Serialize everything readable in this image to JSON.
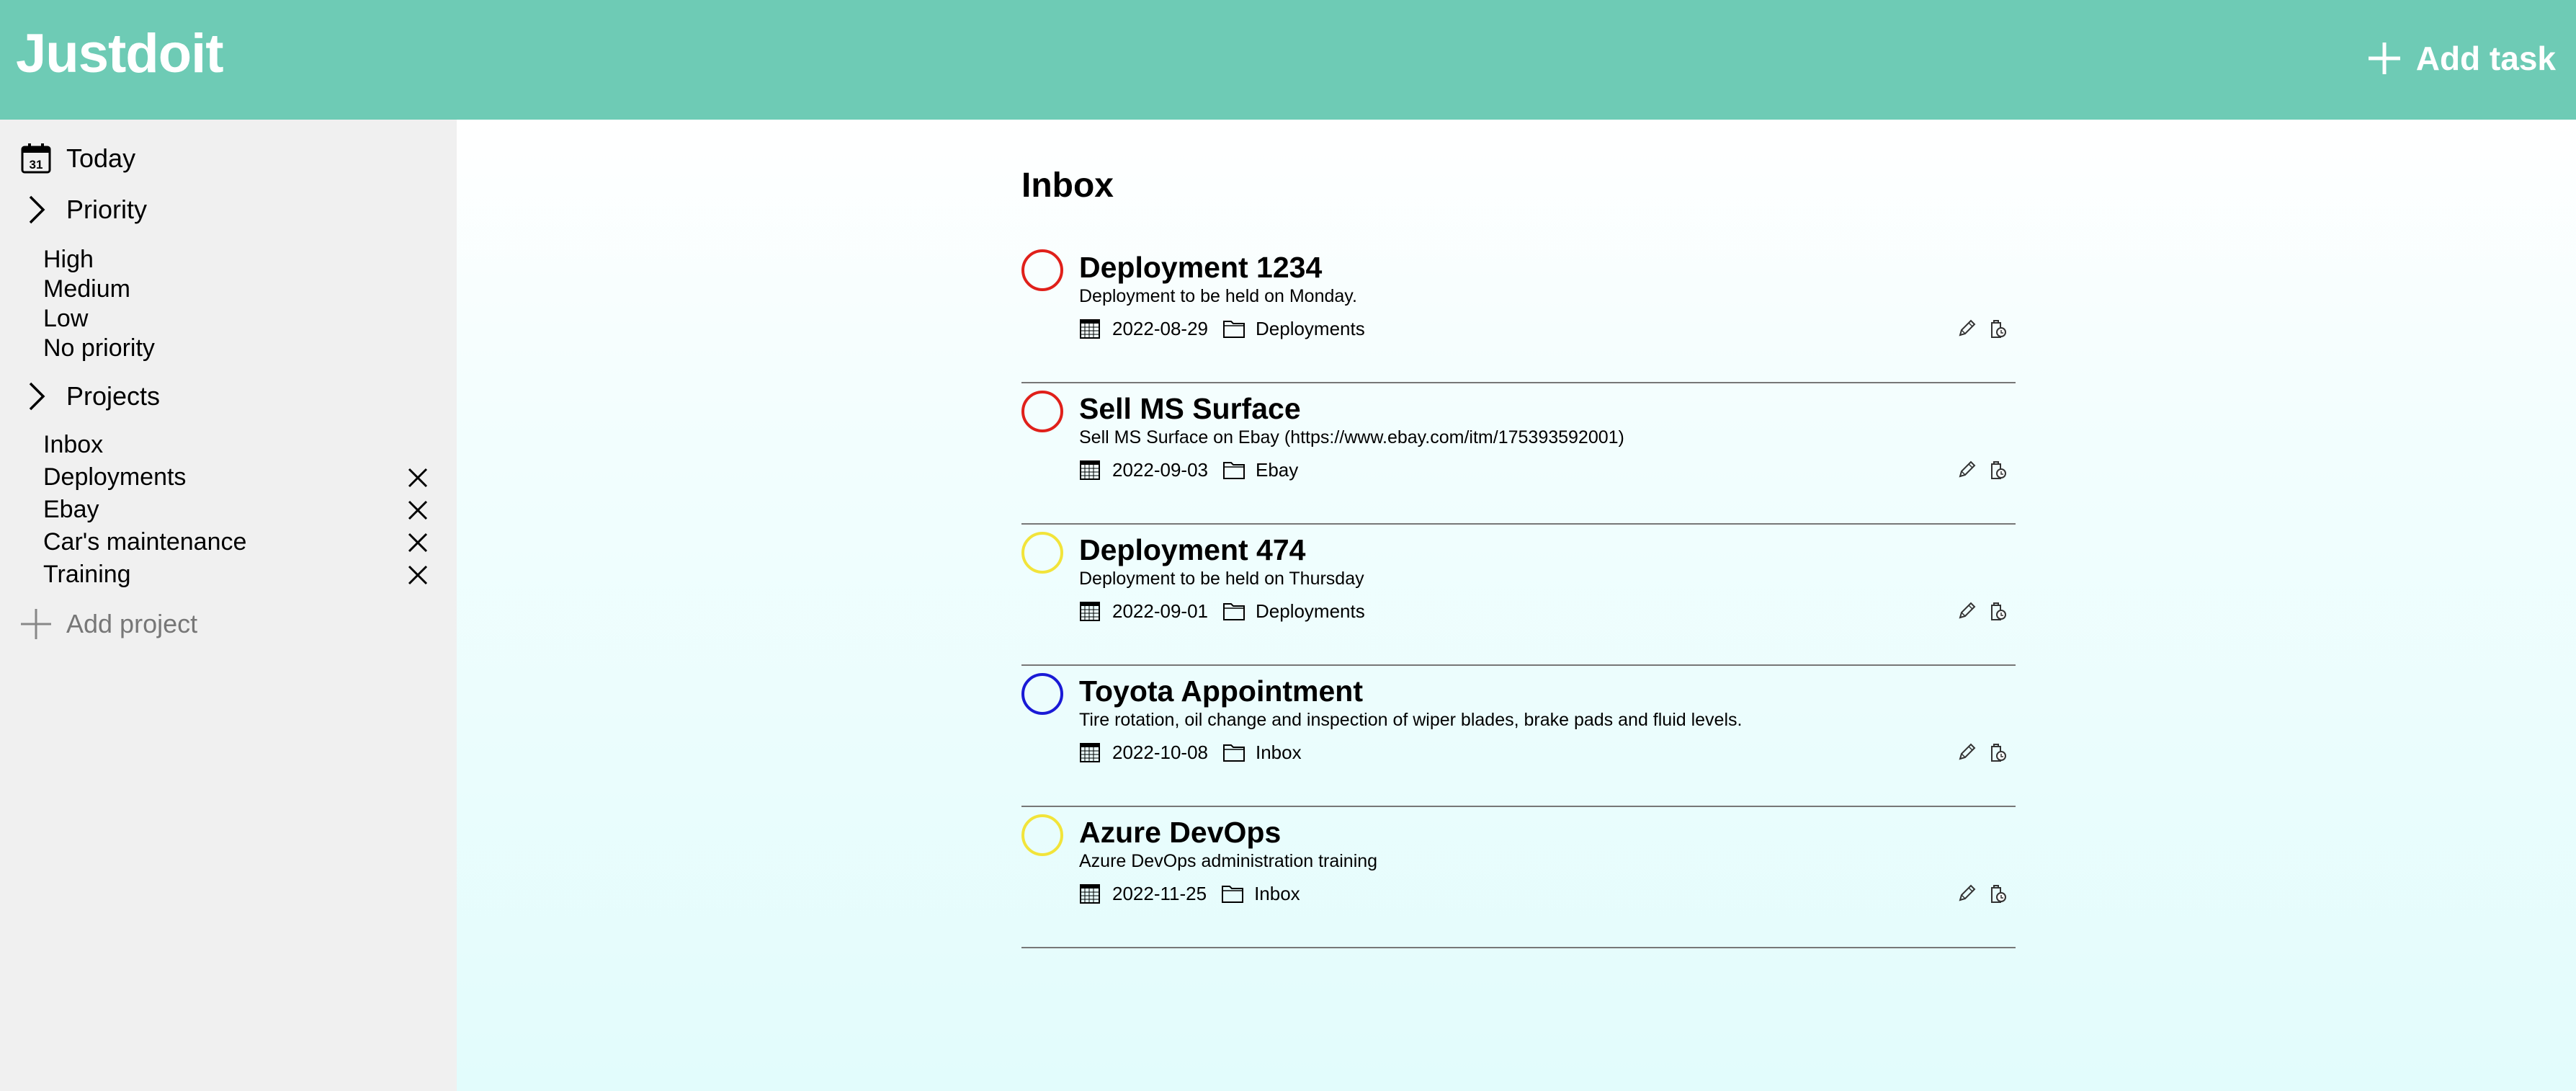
{
  "app": {
    "logo": "Justdoit",
    "add_task_label": "Add task"
  },
  "sidebar": {
    "today_label": "Today",
    "today_day": "31",
    "priority_label": "Priority",
    "priorities": [
      "High",
      "Medium",
      "Low",
      "No priority"
    ],
    "projects_label": "Projects",
    "projects": [
      "Inbox",
      "Deployments",
      "Ebay",
      "Car's maintenance",
      "Training"
    ],
    "add_project_label": "Add project"
  },
  "main": {
    "title": "Inbox",
    "tasks": [
      {
        "title": "Deployment 1234",
        "description": "Deployment to be held on Monday.",
        "date": "2022-08-29",
        "project": "Deployments",
        "priority_color": "#e0201a"
      },
      {
        "title": "Sell MS Surface",
        "description": "Sell MS Surface on Ebay (https://www.ebay.com/itm/175393592001)",
        "date": "2022-09-03",
        "project": "Ebay",
        "priority_color": "#e0201a"
      },
      {
        "title": "Deployment 474",
        "description": "Deployment to be held on Thursday",
        "date": "2022-09-01",
        "project": "Deployments",
        "priority_color": "#f2e43a"
      },
      {
        "title": "Toyota Appointment",
        "description": "Tire rotation, oil change and inspection of wiper blades, brake pads and fluid levels.",
        "date": "2022-10-08",
        "project": "Inbox",
        "priority_color": "#1a1ad6"
      },
      {
        "title": "Azure DevOps",
        "description": "Azure DevOps administration training",
        "date": "2022-11-25",
        "project": "Inbox",
        "priority_color": "#f2e43a"
      }
    ]
  },
  "colors": {
    "header": "#6ecbb5",
    "sidebar": "#f0f0f0"
  },
  "icons": [
    "calendar-icon",
    "chevron-right-icon",
    "close-icon",
    "plus-icon",
    "folder-icon",
    "pencil-icon",
    "trash-icon"
  ]
}
